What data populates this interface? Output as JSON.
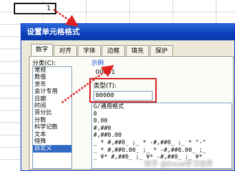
{
  "sheet": {
    "cell_value": "1"
  },
  "dialog": {
    "title": "设置单元格格式",
    "tabs": [
      "数字",
      "对齐",
      "字体",
      "边框",
      "填充",
      "保护"
    ],
    "category_label": "分类(C):",
    "categories": [
      "常规",
      "数值",
      "货币",
      "会计专用",
      "日期",
      "时间",
      "百分比",
      "分数",
      "科学记数",
      "文本",
      "特殊",
      "自定义"
    ],
    "selected_category": "自定义",
    "sample_label": "示例",
    "sample_value": "00001",
    "type_label": "类型(T):",
    "type_value": "00000",
    "formats": [
      "G/通用格式",
      "0",
      "0.00",
      "#,##0",
      "#,##0.00",
      "_ * #,##0_ ;_ * -#,##0_ ;_ * \"-\"",
      "_ * #,##0.00_ ;_ * -#,##0.00_ ;_",
      "_ ¥* #,##0_ ;_ ¥* -#,##0_ ;_ ¥*"
    ]
  },
  "watermark": "知乎 @Excel学习世界"
}
